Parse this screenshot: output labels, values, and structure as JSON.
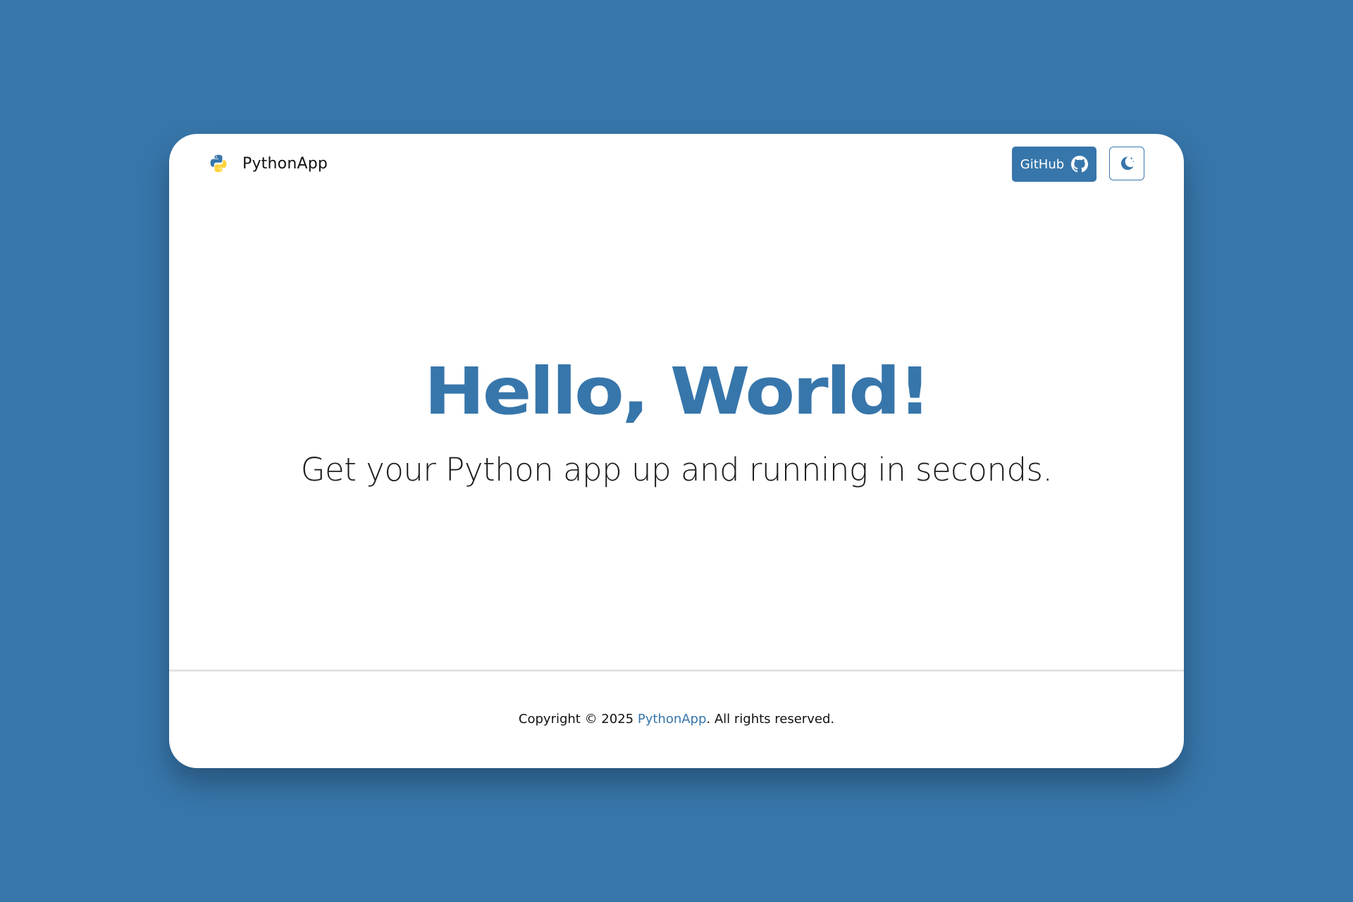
{
  "colors": {
    "background": "#3776ab",
    "accent": "#3776ab",
    "card": "#ffffff",
    "python_yellow": "#ffd43b"
  },
  "navbar": {
    "brand_icon": "python-logo-icon",
    "brand_name": "PythonApp",
    "github_label": "GitHub",
    "github_icon": "github-icon",
    "theme_toggle_icon": "moon-icon"
  },
  "hero": {
    "title": "Hello, World!",
    "subtitle": "Get your Python app up and running in seconds."
  },
  "footer": {
    "prefix": "Copyright © 2025 ",
    "link_text": "PythonApp",
    "suffix": ". All rights reserved."
  }
}
